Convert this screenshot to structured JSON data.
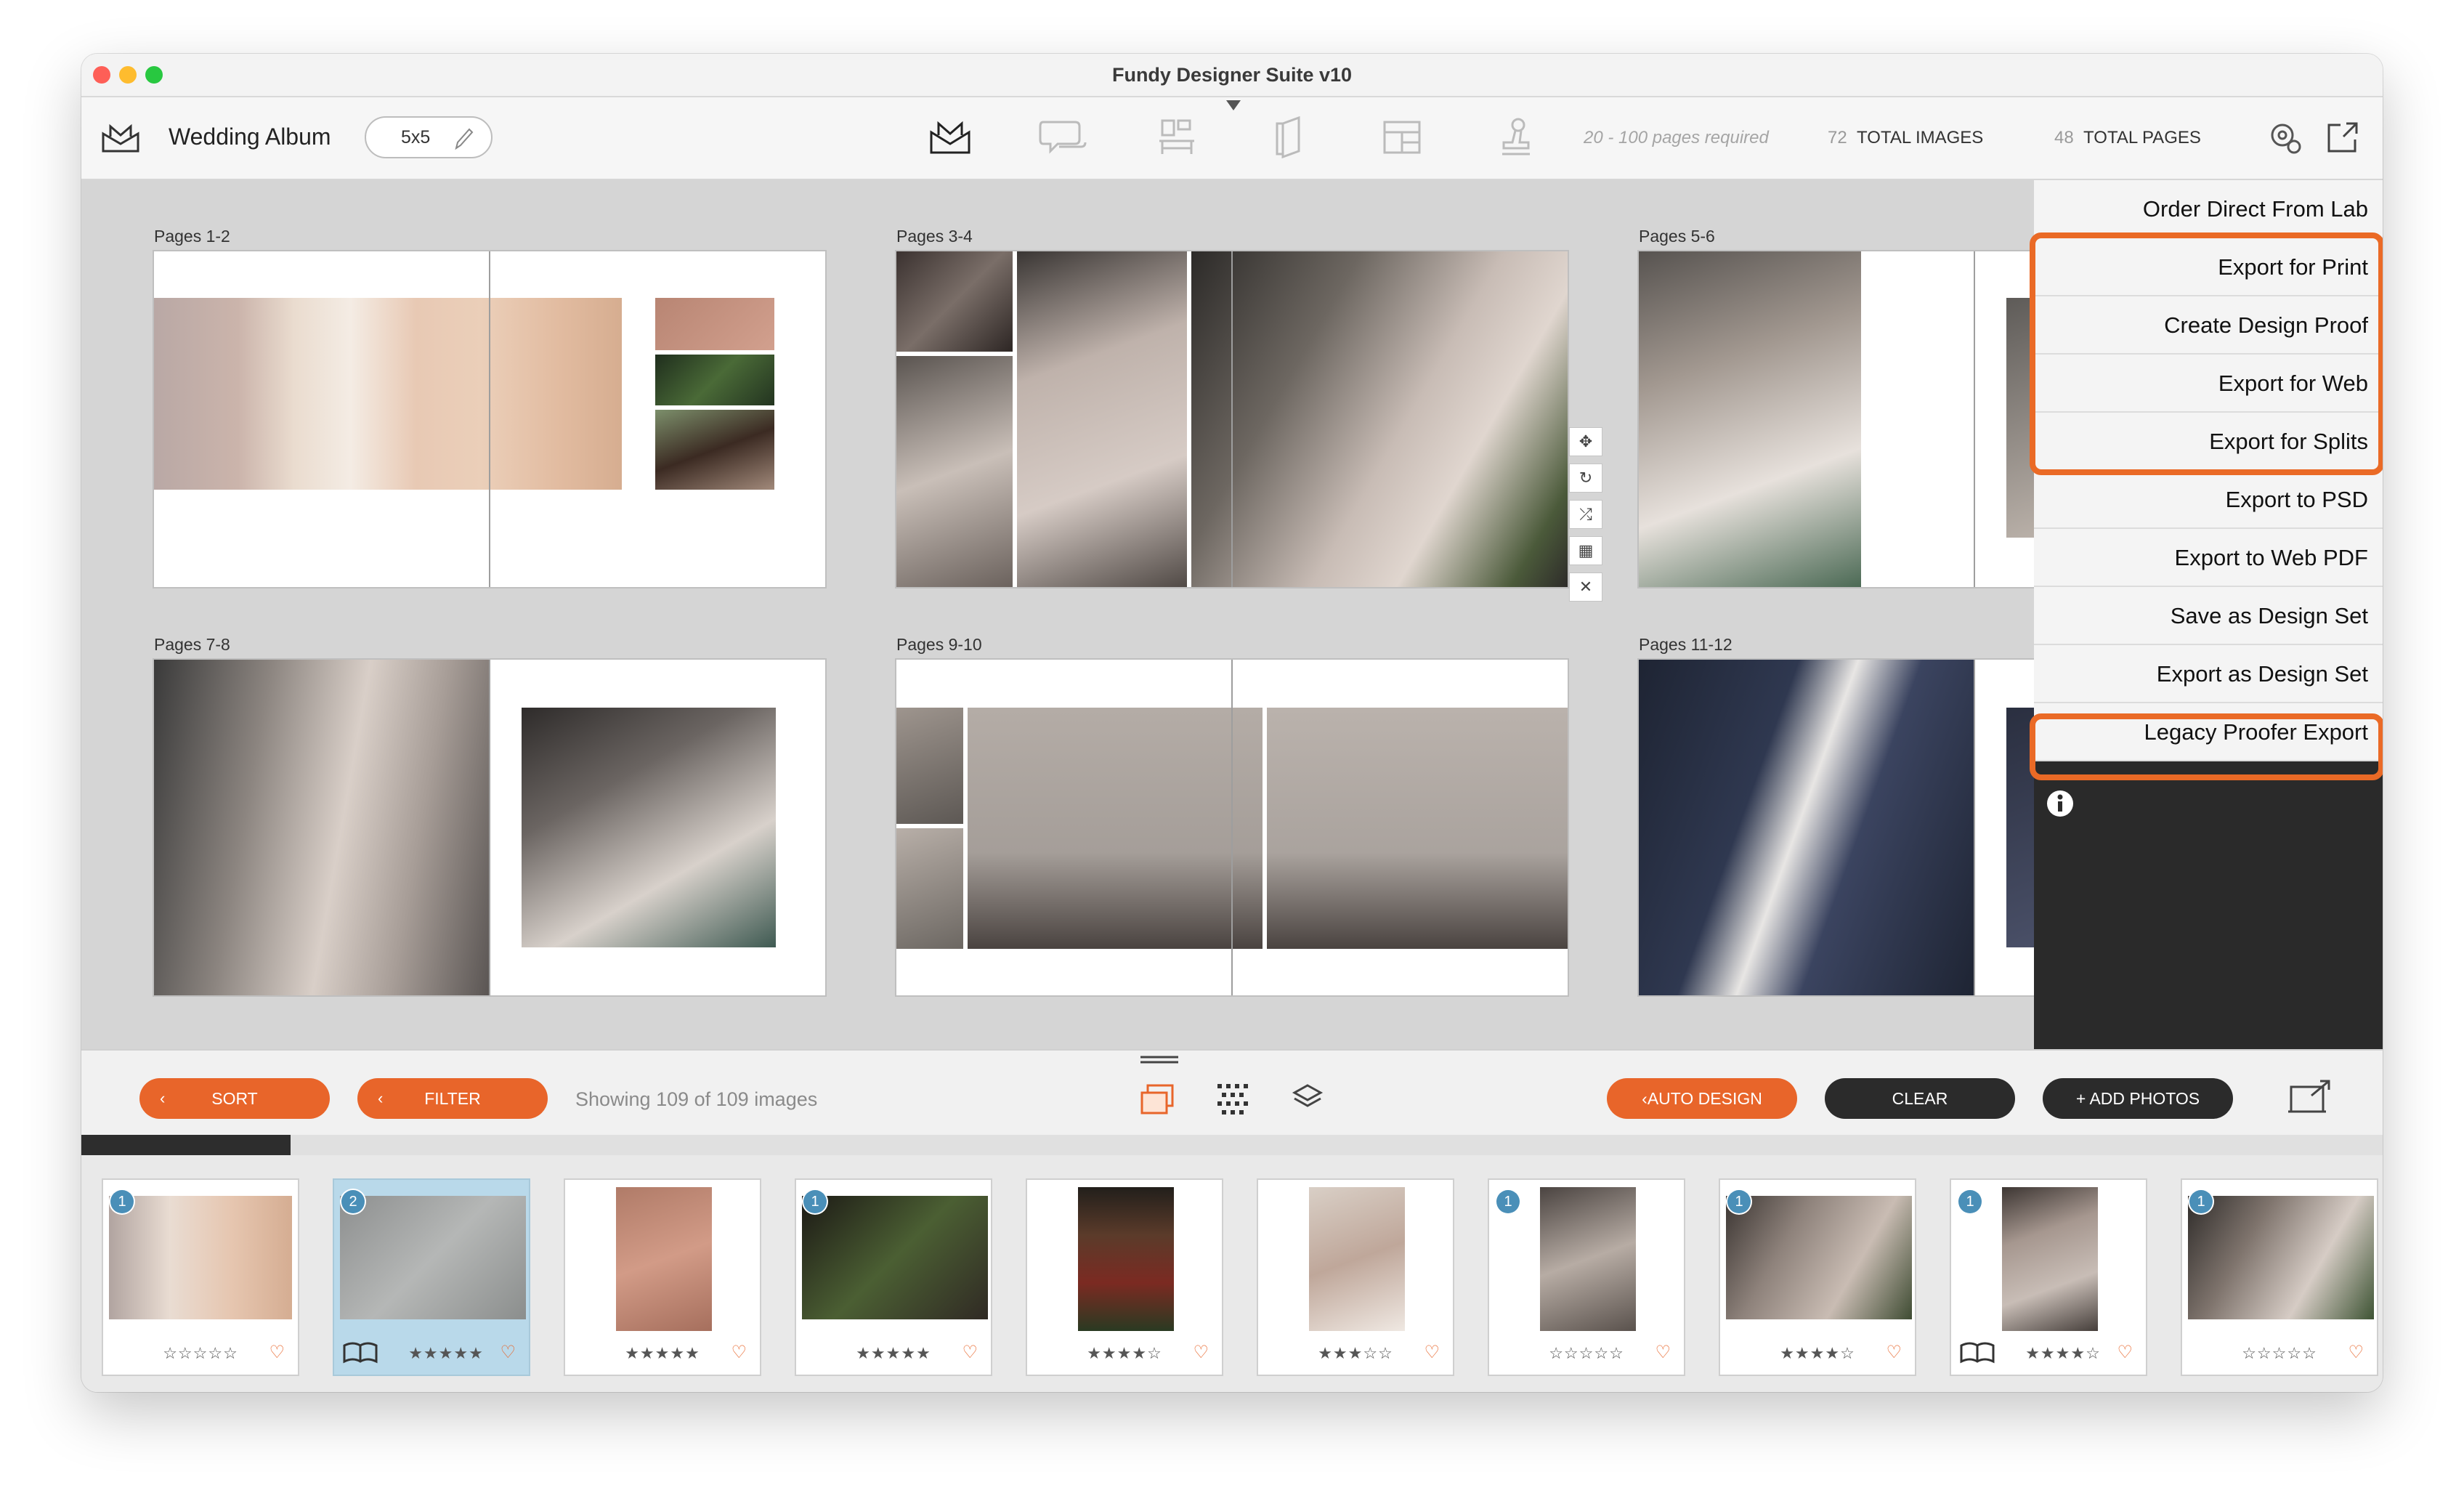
{
  "window": {
    "title": "Fundy Designer Suite v10"
  },
  "toolbar": {
    "album_title": "Wedding Album",
    "size_label": "5x5",
    "pages_required": "20 - 100 pages required",
    "total_images_count": "72",
    "total_images_label": "TOTAL IMAGES",
    "total_pages_count": "48",
    "total_pages_label": "TOTAL PAGES",
    "icons": [
      "album-icon",
      "proofing-icon",
      "wall-art-icon",
      "card-icon",
      "templates-icon",
      "stamp-icon",
      "settings-icon",
      "export-icon"
    ]
  },
  "spreads": [
    {
      "label": "Pages 1-2"
    },
    {
      "label": "Pages 3-4"
    },
    {
      "label": "Pages 5-6"
    },
    {
      "label": "Pages 7-8"
    },
    {
      "label": "Pages 9-10"
    },
    {
      "label": "Pages 11-12"
    }
  ],
  "export_menu": {
    "items": [
      "Order Direct From Lab",
      "Export for Print",
      "Create Design Proof",
      "Export for Web",
      "Export for Splits",
      "Export to PSD",
      "Export to Web PDF",
      "Save as Design Set",
      "Export as Design Set",
      "Legacy Proofer Export"
    ],
    "highlight_color": "#ea6a26"
  },
  "bottombar": {
    "sort_label": "SORT",
    "filter_label": "FILTER",
    "showing_text": "Showing 109 of 109 images",
    "auto_design_label": "AUTO DESIGN",
    "clear_label": "CLEAR",
    "add_photos_label": "+ ADD PHOTOS",
    "accent_color": "#e8652a"
  },
  "filmstrip": {
    "progress_fraction": 0.09,
    "images": [
      {
        "badge": "1",
        "stars": "☆☆☆☆☆",
        "rating": 0,
        "selected": false
      },
      {
        "badge": "2",
        "stars": "★★★★★",
        "rating": 5,
        "selected": true
      },
      {
        "badge": "",
        "stars": "★★★★★",
        "rating": 5,
        "selected": false
      },
      {
        "badge": "1",
        "stars": "★★★★★",
        "rating": 5,
        "selected": false
      },
      {
        "badge": "",
        "stars": "★★★★☆",
        "rating": 4,
        "selected": false
      },
      {
        "badge": "",
        "stars": "★★★☆☆",
        "rating": 3,
        "selected": false
      },
      {
        "badge": "1",
        "stars": "☆☆☆☆☆",
        "rating": 0,
        "selected": false
      },
      {
        "badge": "1",
        "stars": "★★★★☆",
        "rating": 4,
        "selected": false
      },
      {
        "badge": "1",
        "stars": "★★★★☆",
        "rating": 4,
        "selected": false
      },
      {
        "badge": "1",
        "stars": "☆☆☆☆☆",
        "rating": 0,
        "selected": false
      }
    ]
  }
}
